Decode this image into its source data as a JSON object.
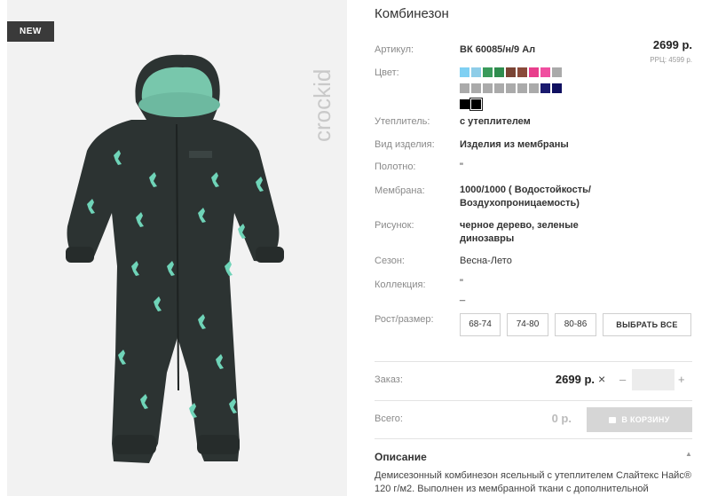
{
  "badge": "NEW",
  "brand": "crockid",
  "title": "Комбинезон",
  "article": {
    "label": "Артикул:",
    "value": "ВК 60085/н/9 Ал"
  },
  "price": {
    "main": "2699 р.",
    "rrp": "РРЦ: 4599 р."
  },
  "color": {
    "label": "Цвет:",
    "swatches": [
      "#7fd0f3",
      "#8ecde8",
      "#3a9a5b",
      "#2f8c4e",
      "#7a4434",
      "#8a4a3a",
      "#e83e8c",
      "#f04fa0",
      "#aaaaaa",
      "#aaaaaa",
      "#aaaaaa",
      "#aaaaaa",
      "#aaaaaa",
      "#aaaaaa",
      "#aaaaaa",
      "#aaaaaa",
      "#1a1a6e",
      "#101060",
      "#000000",
      "#000000"
    ],
    "selected_index": 19
  },
  "specs": [
    {
      "label": "Утеплитель:",
      "value": "с утеплителем"
    },
    {
      "label": "Вид изделия:",
      "value": "Изделия из мембраны"
    },
    {
      "label": "Полотно:",
      "value": "\""
    },
    {
      "label": "Мембрана:",
      "value": "1000/1000 ( Водостойкость/ Воздухопроницаемость)"
    },
    {
      "label": "Рисунок:",
      "value": "черное дерево, зеленые динозавры"
    },
    {
      "label": "Сезон:",
      "value": "Весна-Лето"
    },
    {
      "label": "Коллекция:",
      "value": "\" _"
    }
  ],
  "size": {
    "label": "Рост/размер:",
    "options": [
      "68-74",
      "74-80",
      "80-86"
    ],
    "select_all": "ВЫБРАТЬ ВСЕ"
  },
  "order": {
    "label": "Заказ:",
    "price": "2699 р.",
    "times": "×",
    "minus": "–",
    "plus": "+",
    "qty": ""
  },
  "total": {
    "label": "Всего:",
    "price": "0 р.",
    "cart_button": "В КОРЗИНУ"
  },
  "description": {
    "title": "Описание",
    "text": "Демисезонный комбинезон ясельный с утеплителем Слайтекс Найс® 120 г/м2. Выполнен из мембранной ткани с дополнительной"
  },
  "colors": {
    "garment": "#2c3332",
    "lining": "#78c7ac",
    "dino": "#6fd4b8",
    "panel": "#f2f2f2"
  }
}
